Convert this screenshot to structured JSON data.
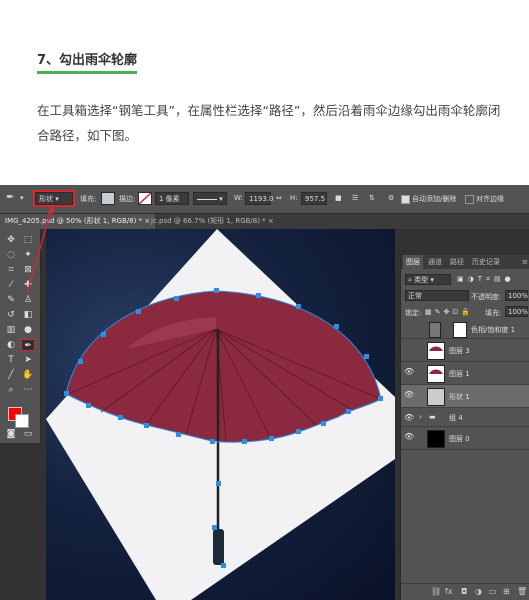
{
  "article": {
    "heading": "7、勾出雨伞轮廓",
    "paragraph": "在工具箱选择“钢笔工具”，在属性栏选择“路径”，然后沿着雨伞边缘勾出雨伞轮廓闭合路径，如下图。"
  },
  "options_bar": {
    "mode_value": "形状",
    "fill_label": "填充:",
    "stroke_label": "描边:",
    "stroke_width": "1 像素",
    "w_label": "W:",
    "w_value": "1193.0",
    "h_label": "H:",
    "h_value": "957.5",
    "auto_add_label": "自动添加/删除",
    "align_edges_label": "对齐边缘"
  },
  "document_tabs": [
    "IMG_4205.psd @ 50% (形状 1, RGB/8) *",
    "jc.psd @ 66.7% (矩形 1, RGB/8) *"
  ],
  "layers_panel": {
    "tabs": [
      "图层",
      "通道",
      "路径",
      "历史记录"
    ],
    "kind_label": "类型",
    "blend_mode": "正常",
    "opacity_label": "不透明度:",
    "opacity_value": "100%",
    "lock_label": "锁定:",
    "fill_label": "填充:",
    "fill_value": "100%",
    "layers": [
      {
        "name": "色相/饱和度 1",
        "visible": false
      },
      {
        "name": "图层 3",
        "visible": false
      },
      {
        "name": "图层 1",
        "visible": true
      },
      {
        "name": "形状 1",
        "visible": true,
        "selected": true
      },
      {
        "name": "组 4",
        "visible": true
      },
      {
        "name": "图层 0",
        "visible": true
      }
    ]
  },
  "colors": {
    "accent_red": "#d9272e",
    "heading_underline": "#4caf50",
    "umbrella": "#8b2a3e",
    "path_anchor": "#2b8fe6"
  }
}
